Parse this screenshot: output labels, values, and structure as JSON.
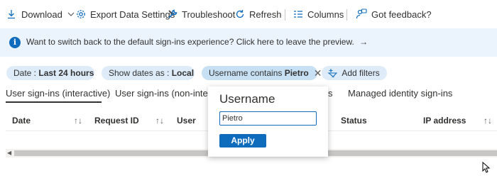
{
  "toolbar": {
    "download": "Download",
    "export": "Export Data Settings",
    "troubleshoot": "Troubleshoot",
    "refresh": "Refresh",
    "columns": "Columns",
    "feedback": "Got feedback?"
  },
  "banner": {
    "text": "Want to switch back to the default sign-ins experience? Click here to leave the preview.",
    "arrow": "→"
  },
  "filters": {
    "date_prefix": "Date : ",
    "date_value": "Last 24 hours",
    "show_prefix": "Show dates as : ",
    "show_value": "Local",
    "username_prefix": "Username contains ",
    "username_value": "Pietro",
    "add": "Add filters"
  },
  "tabs": [
    {
      "label": "User sign-ins (interactive)"
    },
    {
      "label": "User sign-ins (non-interac"
    },
    {
      "label": "s"
    },
    {
      "label": "Managed identity sign-ins"
    }
  ],
  "columns": [
    "Date",
    "Request ID",
    "User",
    "Status",
    "IP address"
  ],
  "popup": {
    "title": "Username",
    "input_value": "Pietro",
    "apply": "Apply"
  },
  "colors": {
    "accent": "#0f6cbd",
    "banner_bg": "#ebf3fc",
    "pill_bg": "#deecf9"
  }
}
